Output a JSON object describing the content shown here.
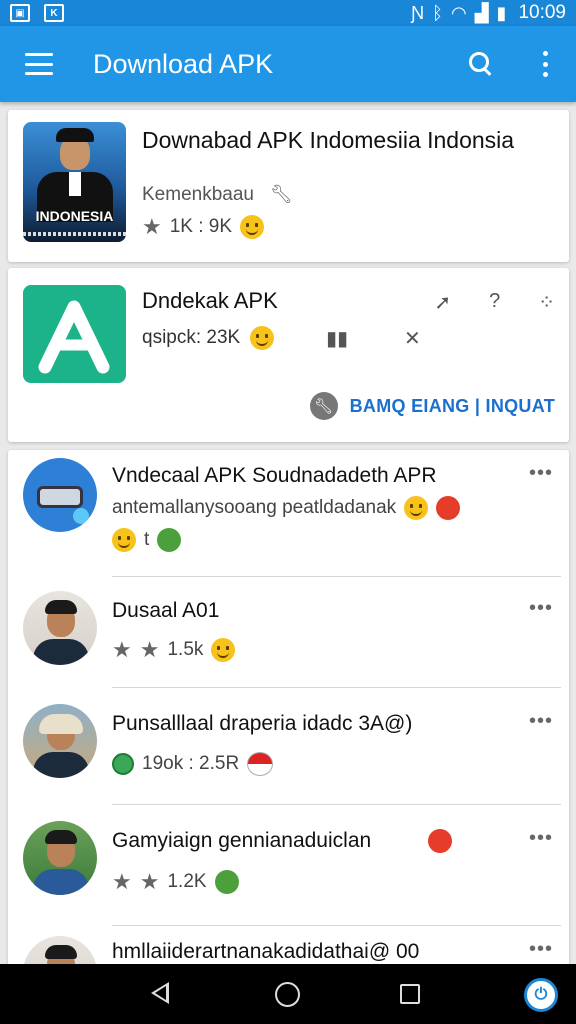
{
  "status_bar": {
    "time": "10:09"
  },
  "app_bar": {
    "title": "Download APK"
  },
  "featured": {
    "title": "Downabad APK Indomesiia Indonsia",
    "subtitle": "Kemenkbaau",
    "thumb_label": "INDONESIA",
    "rating": "1K : 9K"
  },
  "app_card": {
    "title": "Dndekak APK",
    "stats": "qsipck: 23K",
    "action_help": "?",
    "link": "BAMQ EIANG | INQUAT"
  },
  "list": [
    {
      "title": "Vndecaal APK Soudnadadeth APR",
      "subtitle": "antemallanysooang peatldadanak",
      "meta": "t"
    },
    {
      "title": "Dusaal A01",
      "meta": "1.5k"
    },
    {
      "title": "Punsalllaal draperia idadc 3A@)",
      "meta": "19ok : 2.5R"
    },
    {
      "title": "Gamyiaign gennianaduiclan",
      "meta": "1.2K"
    },
    {
      "title": "hmllaiiderartnanakadidathai@ 00"
    }
  ],
  "colors": {
    "primary": "#2196e6",
    "status": "#1a86d8",
    "apk_green": "#1db38a",
    "link": "#1a6fcf"
  }
}
